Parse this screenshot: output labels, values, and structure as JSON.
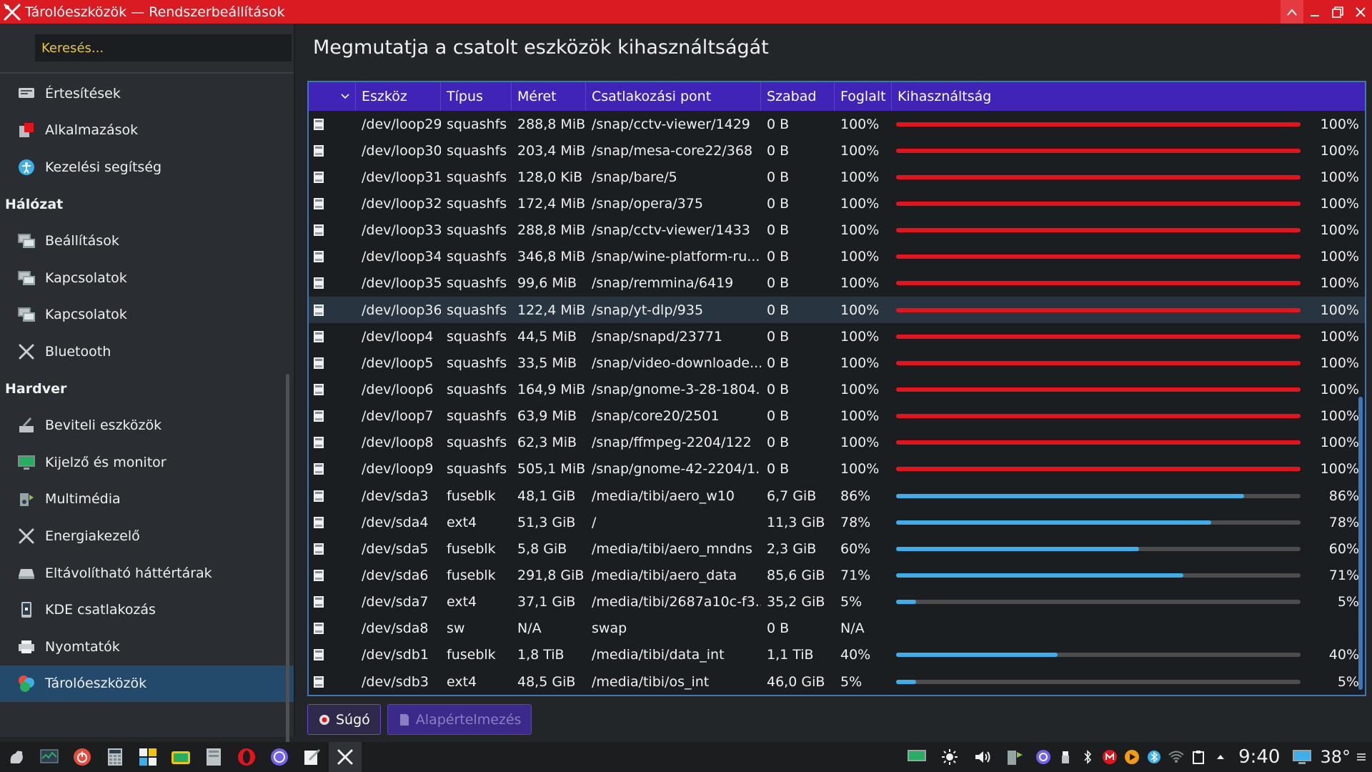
{
  "window": {
    "title": "Tárolóeszközök — Rendszerbeállítások",
    "accent": "#da1b22"
  },
  "sidebar": {
    "search_placeholder": "Keresés...",
    "top_items": [
      {
        "label": "Értesítések",
        "icon": "notifications-icon"
      },
      {
        "label": "Alkalmazások",
        "icon": "applications-icon"
      },
      {
        "label": "Kezelési segítség",
        "icon": "accessibility-icon"
      }
    ],
    "section_network": "Hálózat",
    "network_items": [
      {
        "label": "Beállítások",
        "icon": "network-settings-icon"
      },
      {
        "label": "Kapcsolatok",
        "icon": "network-connections-icon"
      },
      {
        "label": "Kapcsolatok",
        "icon": "network-connections-icon"
      },
      {
        "label": "Bluetooth",
        "icon": "bluetooth-icon"
      }
    ],
    "section_hardware": "Hardver",
    "hardware_items": [
      {
        "label": "Beviteli eszközök",
        "icon": "input-devices-icon"
      },
      {
        "label": "Kijelző és monitor",
        "icon": "display-icon"
      },
      {
        "label": "Multimédia",
        "icon": "multimedia-icon"
      },
      {
        "label": "Energiakezelő",
        "icon": "power-icon"
      },
      {
        "label": "Eltávolítható háttértárak",
        "icon": "removable-storage-icon"
      },
      {
        "label": "KDE csatlakozás",
        "icon": "kde-connect-icon"
      },
      {
        "label": "Nyomtatók",
        "icon": "printer-icon"
      },
      {
        "label": "Tárolóeszközök",
        "icon": "storage-icon",
        "active": true
      }
    ]
  },
  "main": {
    "heading": "Megmutatja a csatolt eszközök kihasználtságát",
    "columns": [
      "Eszköz",
      "Típus",
      "Méret",
      "Csatlakozási pont",
      "Szabad",
      "Foglalt",
      "Kihasználtság"
    ],
    "rows": [
      {
        "device": "/dev/loop29",
        "type": "squashfs",
        "size": "288,8 MiB",
        "mount": "/snap/cctv-viewer/1429",
        "free": "0 B",
        "used": "100%",
        "usage": 100,
        "usage_label": "100%"
      },
      {
        "device": "/dev/loop30",
        "type": "squashfs",
        "size": "203,4 MiB",
        "mount": "/snap/mesa-core22/368",
        "free": "0 B",
        "used": "100%",
        "usage": 100,
        "usage_label": "100%"
      },
      {
        "device": "/dev/loop31",
        "type": "squashfs",
        "size": "128,0 KiB",
        "mount": "/snap/bare/5",
        "free": "0 B",
        "used": "100%",
        "usage": 100,
        "usage_label": "100%"
      },
      {
        "device": "/dev/loop32",
        "type": "squashfs",
        "size": "172,4 MiB",
        "mount": "/snap/opera/375",
        "free": "0 B",
        "used": "100%",
        "usage": 100,
        "usage_label": "100%"
      },
      {
        "device": "/dev/loop33",
        "type": "squashfs",
        "size": "288,8 MiB",
        "mount": "/snap/cctv-viewer/1433",
        "free": "0 B",
        "used": "100%",
        "usage": 100,
        "usage_label": "100%"
      },
      {
        "device": "/dev/loop34",
        "type": "squashfs",
        "size": "346,8 MiB",
        "mount": "/snap/wine-platform-ru...",
        "free": "0 B",
        "used": "100%",
        "usage": 100,
        "usage_label": "100%"
      },
      {
        "device": "/dev/loop35",
        "type": "squashfs",
        "size": "99,6 MiB",
        "mount": "/snap/remmina/6419",
        "free": "0 B",
        "used": "100%",
        "usage": 100,
        "usage_label": "100%"
      },
      {
        "device": "/dev/loop36",
        "type": "squashfs",
        "size": "122,4 MiB",
        "mount": "/snap/yt-dlp/935",
        "free": "0 B",
        "used": "100%",
        "usage": 100,
        "usage_label": "100%",
        "hover": true
      },
      {
        "device": "/dev/loop4",
        "type": "squashfs",
        "size": "44,5 MiB",
        "mount": "/snap/snapd/23771",
        "free": "0 B",
        "used": "100%",
        "usage": 100,
        "usage_label": "100%"
      },
      {
        "device": "/dev/loop5",
        "type": "squashfs",
        "size": "33,5 MiB",
        "mount": "/snap/video-downloade...",
        "free": "0 B",
        "used": "100%",
        "usage": 100,
        "usage_label": "100%"
      },
      {
        "device": "/dev/loop6",
        "type": "squashfs",
        "size": "164,9 MiB",
        "mount": "/snap/gnome-3-28-1804...",
        "free": "0 B",
        "used": "100%",
        "usage": 100,
        "usage_label": "100%"
      },
      {
        "device": "/dev/loop7",
        "type": "squashfs",
        "size": "63,9 MiB",
        "mount": "/snap/core20/2501",
        "free": "0 B",
        "used": "100%",
        "usage": 100,
        "usage_label": "100%"
      },
      {
        "device": "/dev/loop8",
        "type": "squashfs",
        "size": "62,3 MiB",
        "mount": "/snap/ffmpeg-2204/122",
        "free": "0 B",
        "used": "100%",
        "usage": 100,
        "usage_label": "100%"
      },
      {
        "device": "/dev/loop9",
        "type": "squashfs",
        "size": "505,1 MiB",
        "mount": "/snap/gnome-42-2204/1...",
        "free": "0 B",
        "used": "100%",
        "usage": 100,
        "usage_label": "100%"
      },
      {
        "device": "/dev/sda3",
        "type": "fuseblk",
        "size": "48,1 GiB",
        "mount": "/media/tibi/aero_w10",
        "free": "6,7 GiB",
        "used": "86%",
        "usage": 86,
        "usage_label": "86%"
      },
      {
        "device": "/dev/sda4",
        "type": "ext4",
        "size": "51,3 GiB",
        "mount": "/",
        "free": "11,3 GiB",
        "used": "78%",
        "usage": 78,
        "usage_label": "78%"
      },
      {
        "device": "/dev/sda5",
        "type": "fuseblk",
        "size": "5,8 GiB",
        "mount": "/media/tibi/aero_mndns",
        "free": "2,3 GiB",
        "used": "60%",
        "usage": 60,
        "usage_label": "60%"
      },
      {
        "device": "/dev/sda6",
        "type": "fuseblk",
        "size": "291,8 GiB",
        "mount": "/media/tibi/aero_data",
        "free": "85,6 GiB",
        "used": "71%",
        "usage": 71,
        "usage_label": "71%"
      },
      {
        "device": "/dev/sda7",
        "type": "ext4",
        "size": "37,1 GiB",
        "mount": "/media/tibi/2687a10c-f3...",
        "free": "35,2 GiB",
        "used": "5%",
        "usage": 5,
        "usage_label": "5%"
      },
      {
        "device": "/dev/sda8",
        "type": "sw",
        "size": "N/A",
        "mount": "swap",
        "free": "0 B",
        "used": "N/A",
        "usage": null,
        "usage_label": ""
      },
      {
        "device": "/dev/sdb1",
        "type": "fuseblk",
        "size": "1,8 TiB",
        "mount": "/media/tibi/data_int",
        "free": "1,1 TiB",
        "used": "40%",
        "usage": 40,
        "usage_label": "40%"
      },
      {
        "device": "/dev/sdb3",
        "type": "ext4",
        "size": "48,5 GiB",
        "mount": "/media/tibi/os_int",
        "free": "46,0 GiB",
        "used": "5%",
        "usage": 5,
        "usage_label": "5%"
      }
    ],
    "colors": {
      "full": "#e5141c",
      "normal": "#3daee9"
    },
    "buttons": {
      "help": "Súgó",
      "defaults": "Alapértelmezés"
    }
  },
  "taskbar": {
    "apps": [
      "kde-menu-icon",
      "system-monitor-icon",
      "shutdown-icon",
      "calculator-icon",
      "widgets-icon",
      "tv-icon",
      "file-manager-icon",
      "opera-icon",
      "viber-icon",
      "text-editor-icon",
      "system-settings-icon"
    ],
    "tray": [
      "display-config-icon",
      "brightness-icon",
      "volume-icon",
      "network-device-icon",
      "viber-tray-icon",
      "usb-icon",
      "bluetooth-tray-icon",
      "mail-icon",
      "media-player-icon",
      "bluetooth-icon-2",
      "wifi-icon",
      "clipboard-icon",
      "expand-tray-icon"
    ],
    "clock": "9:40",
    "temperature": "38°"
  }
}
